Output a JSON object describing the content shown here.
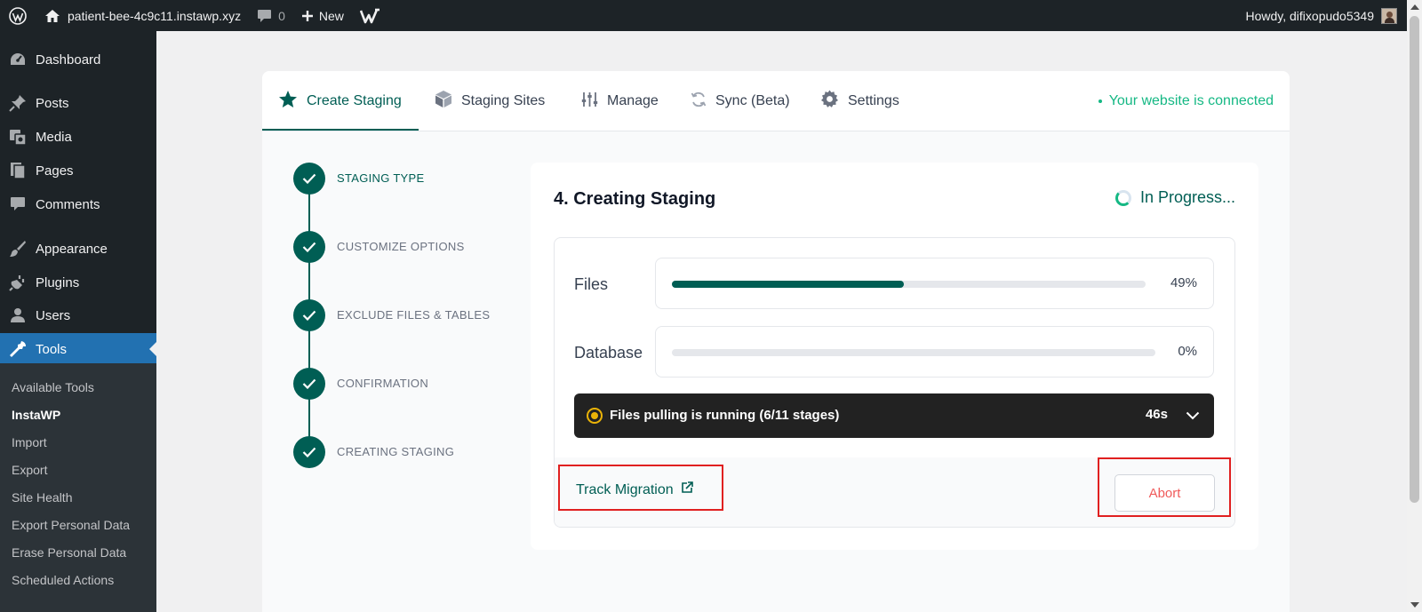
{
  "adminbar": {
    "site_name": "patient-bee-4c9c11.instawp.xyz",
    "comments_count": "0",
    "new_label": "New",
    "howdy": "Howdy, difixopudo5349"
  },
  "sidebar": {
    "items": [
      {
        "label": "Dashboard",
        "icon": "dashboard-icon"
      },
      {
        "label": "Posts",
        "icon": "pin-icon"
      },
      {
        "label": "Media",
        "icon": "media-icon"
      },
      {
        "label": "Pages",
        "icon": "pages-icon"
      },
      {
        "label": "Comments",
        "icon": "comment-icon"
      },
      {
        "label": "Appearance",
        "icon": "brush-icon"
      },
      {
        "label": "Plugins",
        "icon": "plugin-icon"
      },
      {
        "label": "Users",
        "icon": "user-icon"
      },
      {
        "label": "Tools",
        "icon": "wrench-icon"
      }
    ],
    "submenu": [
      "Available Tools",
      "InstaWP",
      "Import",
      "Export",
      "Site Health",
      "Export Personal Data",
      "Erase Personal Data",
      "Scheduled Actions"
    ]
  },
  "tabs": [
    {
      "label": "Create Staging",
      "icon": "star-icon"
    },
    {
      "label": "Staging Sites",
      "icon": "cube-icon"
    },
    {
      "label": "Manage",
      "icon": "sliders-icon"
    },
    {
      "label": "Sync (Beta)",
      "icon": "sync-icon"
    },
    {
      "label": "Settings",
      "icon": "gear-icon"
    }
  ],
  "connection_status": "Your website is connected",
  "steps": [
    "STAGING TYPE",
    "CUSTOMIZE OPTIONS",
    "EXCLUDE FILES & TABLES",
    "CONFIRMATION",
    "CREATING STAGING"
  ],
  "panel": {
    "title": "4. Creating Staging",
    "status": "In Progress...",
    "files_label": "Files",
    "files_progress": 49,
    "files_pct": "49%",
    "database_label": "Database",
    "database_progress": 0,
    "database_pct": "0%",
    "running_text": "Files pulling is running (6/11 stages)",
    "elapsed": "46s",
    "track_label": "Track Migration",
    "abort_label": "Abort"
  },
  "colors": {
    "brand": "#005e54",
    "connected": "#15b884",
    "abort": "#f05a5a",
    "highlight": "#e02020"
  }
}
